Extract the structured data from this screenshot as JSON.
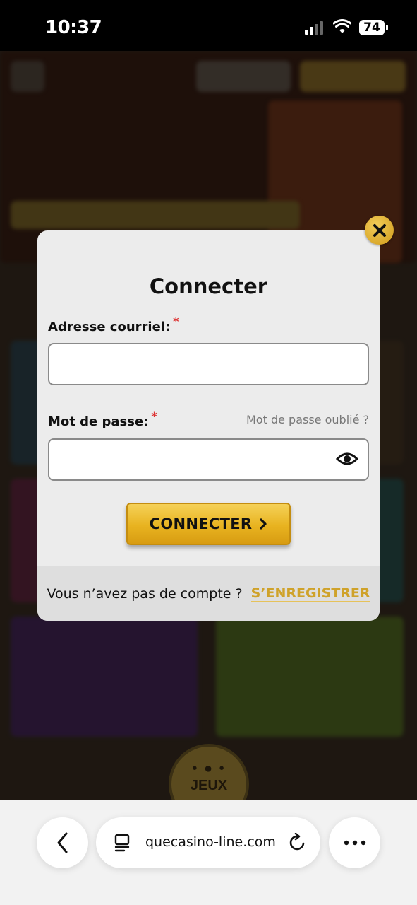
{
  "status_bar": {
    "time": "10:37",
    "battery": "74"
  },
  "modal": {
    "title": "Connecter",
    "email_label": "Adresse courriel:",
    "required_mark": "*",
    "password_label": "Mot de passe:",
    "forgot_password": "Mot de passe oublié ?",
    "submit_label": "CONNECTER",
    "footer_text": "Vous n’avez pas de compte ?",
    "register_label": "S’ENREGISTRER"
  },
  "background": {
    "jeux_label": "JEUX",
    "jeux_dots": "• ● •"
  },
  "browser": {
    "url": "quecasino-line.com"
  },
  "colors": {
    "accent_gold": "#e8b320",
    "link_gold": "#cfa22a",
    "required_red": "#dd3333"
  }
}
